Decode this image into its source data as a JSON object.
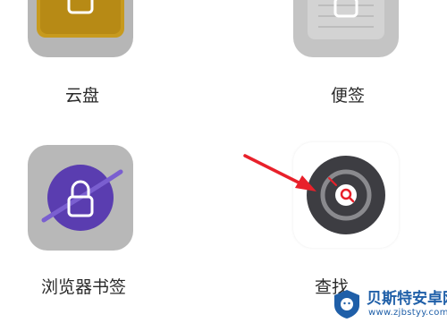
{
  "apps": [
    {
      "label": "云盘",
      "icon": "lock-cloud-icon"
    },
    {
      "label": "便签",
      "icon": "lock-notes-icon"
    },
    {
      "label": "浏览器书签",
      "icon": "lock-planet-icon"
    },
    {
      "label": "查找",
      "icon": "find-device-icon"
    }
  ],
  "annotation": {
    "icon": "red-arrow-icon",
    "color": "#e8202a"
  },
  "watermark": {
    "title": "贝斯特安卓网",
    "url": "www.zjbstyy.com",
    "icon": "android-badge-icon"
  },
  "colors": {
    "cloud_accent": "#c79a1e",
    "bookmarks_accent": "#5a3db0",
    "find_dial": "#3d3d42",
    "arrow": "#e8202a",
    "watermark": "#1f5fa8"
  }
}
